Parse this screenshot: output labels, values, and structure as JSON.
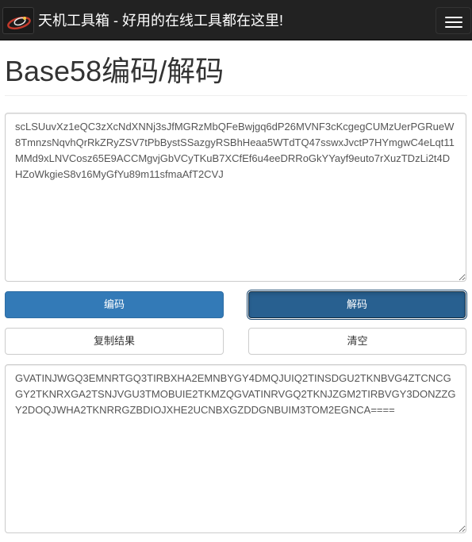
{
  "navbar": {
    "brand": "天机工具箱 - 好用的在线工具都在这里!",
    "logo_icon": "site-logo-swirl-icon",
    "menu_icon": "hamburger-menu-icon"
  },
  "page": {
    "title": "Base58编码/解码"
  },
  "input": {
    "value": "scLSUuvXz1eQC3zXcNdXNNj3sJfMGRzMbQFeBwjgq6dP26MVNF3cKcgegCUMzUerPGRueW8TmnzsNqvhQrRkZRyZSV7tPbBystSSazgyRSBhHeaa5WTdTQ47sswxJvctP7HYmgwC4eLqt11MMd9xLNVCosz65E9ACCMgvjGbVCyTKuB7XCfEf6u4eeDRRoGkYYayf9euto7rXuzTDzLi2t4DHZoWkgieS8v16MyGfYu89m11sfmaAfT2CVJ"
  },
  "buttons": {
    "encode": "编码",
    "decode": "解码",
    "copy": "复制结果",
    "clear": "清空"
  },
  "output": {
    "value": "GVATINJWGQ3EMNRTGQ3TIRBXHA2EMNBYGY4DMQJUIQ2TINSDGU2TKNBVG4ZTCNCGGY2TKNRXGA2TSNJVGU3TMOBUIE2TKMZQGVATINRVGQ2TKNJZGM2TIRBVGY3DONZZGY2DOQJWHA2TKNRRGZBDIOJXHE2UCNBXGZDDGNBUIM3TOM2EGNCA===="
  },
  "colors": {
    "navbar_bg": "#222222",
    "primary": "#337ab7",
    "primary_active": "#286090"
  }
}
